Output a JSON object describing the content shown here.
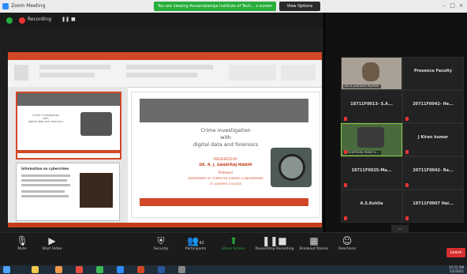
{
  "window": {
    "title": "Zoom Meeting",
    "share_banner": "You are viewing Annamalairaja Institute of Tech... s screen",
    "view_options": "View Options"
  },
  "recording": {
    "label": "Recording",
    "controls": "❚❚ ■"
  },
  "slide": {
    "title_line1": "Crime investigation",
    "title_line2": "with",
    "title_line3": "digital data and forensics",
    "presented_by": "PRESENTED BY",
    "presenter": "DR. R. J. SAHAYRAJ MARIM",
    "designation": "Professor",
    "dept": "DEPARTMENT OF COMPUTER SCIENCE & ENGINEERING",
    "college": "ST. JOSEPH'S COLLEGE"
  },
  "thumbs": {
    "t1_line1": "Crime investigation",
    "t1_line2": "with",
    "t1_line3": "digital data and forensics",
    "t2_title": "Information on cybercrime"
  },
  "participants": [
    {
      "name": "Dr.S.Ganesh Kumar",
      "video": true,
      "muted": false
    },
    {
      "name": "Presence Faculty",
      "video": false,
      "muted": false
    },
    {
      "name": "18711F0013- S.A...",
      "video": false,
      "muted": true
    },
    {
      "name": "20711F0042- He...",
      "video": false,
      "muted": true
    },
    {
      "name": "Annamalai Kala S...",
      "video": true,
      "muted": true
    },
    {
      "name": "J Kiran kumar",
      "video": false,
      "muted": true
    },
    {
      "name": "18711F0025-Ma...",
      "video": false,
      "muted": true
    },
    {
      "name": "20711F0042- Ra...",
      "video": false,
      "muted": true
    },
    {
      "name": "A.S.Kohila",
      "video": false,
      "muted": true
    },
    {
      "name": "18711F0007 Hai...",
      "video": false,
      "muted": true
    }
  ],
  "toolbar": {
    "mute": "Mute",
    "start_video": "Start Video",
    "security": "Security",
    "participants": "Participants",
    "participants_count": "42",
    "share_screen": "Share Screen",
    "recording": "Pause/Stop Recording",
    "breakout": "Breakout Rooms",
    "reactions": "Reactions",
    "leave": "Leave"
  },
  "tray": {
    "time": "10:22 AM",
    "date": "5/3/2021"
  },
  "colors": {
    "accent_green": "#27ae3a",
    "ppt_red": "#d24726",
    "leave_red": "#d62f2f"
  }
}
